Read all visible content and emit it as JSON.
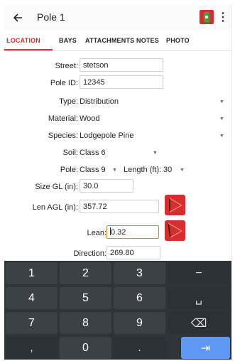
{
  "app": {
    "title": "Pole 1",
    "back_icon": "arrow-back-icon",
    "status_icon": "pole-status-icon",
    "menu_icon": "more-vert-icon",
    "accent_color": "#d32f2f"
  },
  "tabs": [
    {
      "label": "LOCATION",
      "active": true
    },
    {
      "label": "BAYS",
      "active": false
    },
    {
      "label": "ATTACHMENTS",
      "active": false
    },
    {
      "label": "NOTES",
      "active": false
    },
    {
      "label": "PHOTO",
      "active": false
    }
  ],
  "form": {
    "street": {
      "label": "Street:",
      "value": "stetson"
    },
    "pole_id": {
      "label": "Pole ID:",
      "value": "12345"
    },
    "type": {
      "label": "Type:",
      "value": "Distribution"
    },
    "material": {
      "label": "Material:",
      "value": "Wood"
    },
    "species": {
      "label": "Species:",
      "value": "Lodgepole Pine"
    },
    "soil": {
      "label": "Soil:",
      "value": "Class 6"
    },
    "pole": {
      "label": "Pole:",
      "value": "Class 9"
    },
    "length": {
      "label": "Length (ft):",
      "value": "30"
    },
    "size_gl": {
      "label": "Size GL (in):",
      "value": "30.0"
    },
    "len_agl": {
      "label": "Len AGL (in):",
      "value": "357.72"
    },
    "lean": {
      "label": "Lean:",
      "value": "0.32"
    },
    "direction": {
      "label": "Direction:",
      "value": "269.80"
    }
  },
  "keyboard": {
    "rows": [
      [
        "1",
        "2",
        "3",
        "−"
      ],
      [
        "4",
        "5",
        "6",
        "␣"
      ],
      [
        "7",
        "8",
        "9",
        "⌫"
      ],
      [
        ",",
        "0",
        ".",
        "⇥"
      ]
    ]
  }
}
